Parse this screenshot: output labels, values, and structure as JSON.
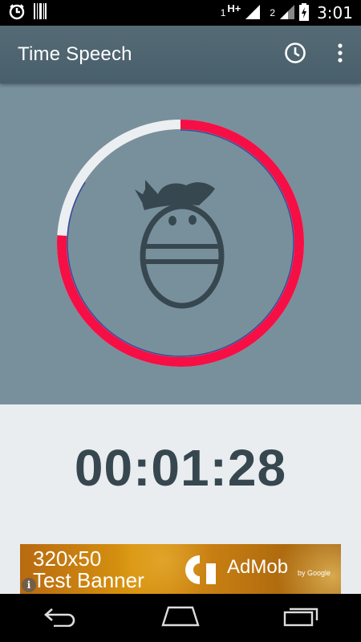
{
  "status_bar": {
    "sim1_label": "1",
    "network_type": "H+",
    "sim2_label": "2",
    "time": "3:01"
  },
  "app_bar": {
    "title": "Time Speech",
    "history_icon": "clock-icon",
    "menu_icon": "overflow-menu-icon"
  },
  "dial": {
    "progress_fraction": 0.76,
    "progress_color": "#f50f45",
    "track_color": "#eceff1",
    "inner_line_color": "#3a4a9a",
    "center_icon": "face-icon"
  },
  "timer": {
    "elapsed": "00:01:28"
  },
  "ad": {
    "size_label": "320x50",
    "text": "Test Banner",
    "brand": "AdMob",
    "by": "by Google",
    "info_label": "i"
  },
  "nav_bar": {
    "back_icon": "back-icon",
    "home_icon": "home-icon",
    "recents_icon": "recents-icon"
  },
  "colors": {
    "app_bar": "#4f6570",
    "hero_background": "#78909c",
    "timer_text": "#37474f"
  }
}
